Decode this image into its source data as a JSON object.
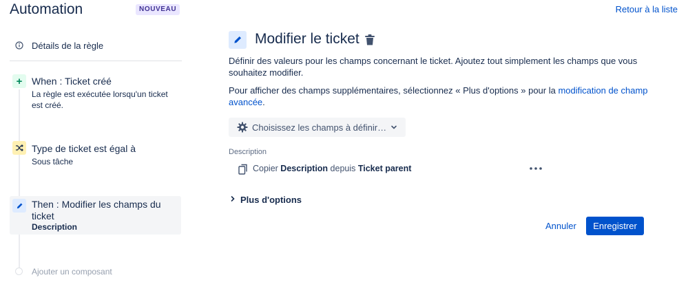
{
  "header": {
    "title": "Automation",
    "badge": "NOUVEAU",
    "back_link": "Retour à la liste"
  },
  "sidebar": {
    "details": {
      "label": "Détails de la règle",
      "icon": "info-icon"
    },
    "steps": [
      {
        "icon": "plus-icon",
        "title": "When : Ticket créé",
        "subtitle": "La règle est exécutée lorsqu'un ticket est créé."
      },
      {
        "icon": "shuffle-icon",
        "title": "Type de ticket est égal à",
        "subtitle": "Sous tâche"
      },
      {
        "icon": "pencil-icon",
        "title": "Then : Modifier les champs du ticket",
        "subtitle": "Description",
        "selected": true
      }
    ],
    "add_component": "Ajouter un composant"
  },
  "main": {
    "title": "Modifier le ticket",
    "description": "Définir des valeurs pour les champs concernant le ticket. Ajoutez tout simplement les champs que vous souhaitez modifier.",
    "more_info_prefix": "Pour afficher des champs supplémentaires, sélectionnez « Plus d'options » pour la ",
    "more_info_link": "modification de champ avancée",
    "more_info_suffix": ".",
    "choose_fields_button": "Choisissez les champs à définir…",
    "field": {
      "label": "Description",
      "value_prefix": "Copier ",
      "value_field": "Description",
      "value_middle": " depuis ",
      "value_source": "Ticket parent"
    },
    "more_options": "Plus d'options",
    "cancel": "Annuler",
    "save": "Enregistrer"
  },
  "colors": {
    "primary": "#0052cc",
    "text": "#172b4d",
    "badge_bg": "#eae6ff",
    "badge_text": "#403294",
    "trigger_bg": "#e3fcef",
    "condition_bg": "#fff0b3",
    "action_bg": "#deebff",
    "selected_bg": "#f4f5f7"
  }
}
